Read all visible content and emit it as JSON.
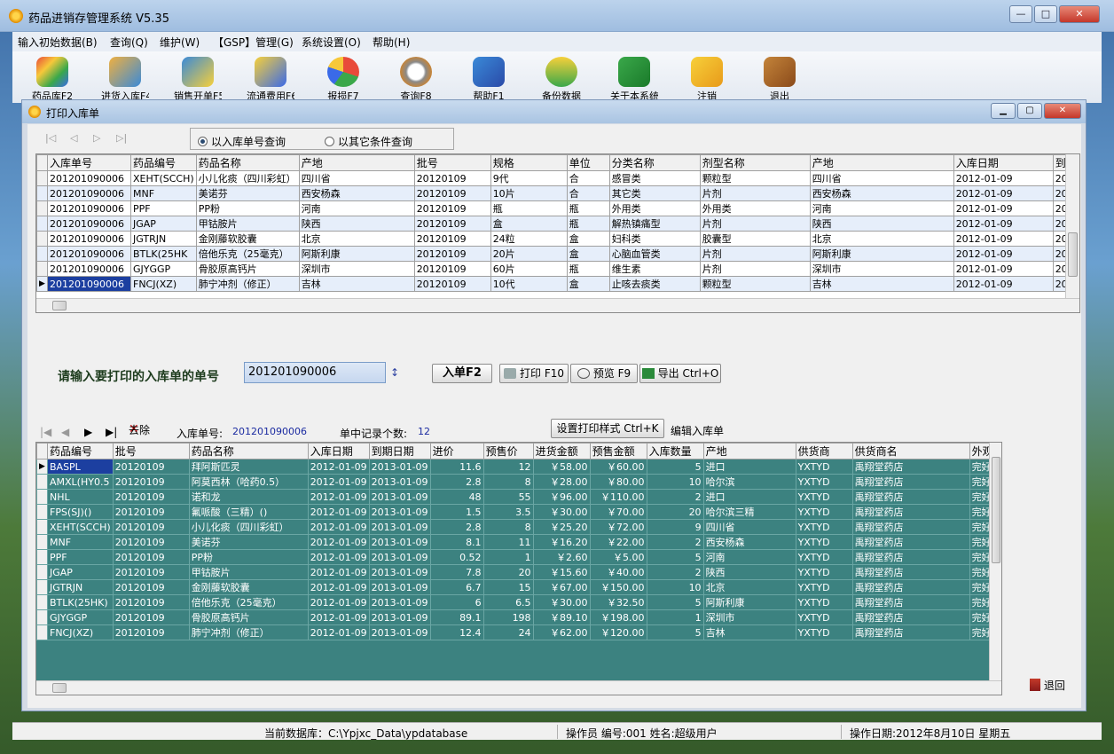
{
  "window": {
    "title": "药品进销存管理系统 V5.35",
    "min": "—",
    "max": "□",
    "close": "✕"
  },
  "menu": [
    "输入初始数据(B)",
    "查询(Q)",
    "维护(W)",
    "【GSP】管理(G)",
    "系统设置(O)",
    "帮助(H)"
  ],
  "toolbar": [
    "药品库F2",
    "进货入库F4",
    "销售开单F5",
    "流通费用F6",
    "报损F7",
    "查询F8",
    "帮助F1",
    "备份数据",
    "关于本系统",
    "注销",
    "退出"
  ],
  "child": {
    "title": "打印入库单",
    "min": "▁",
    "max": "▢",
    "close": "✕"
  },
  "radio": {
    "option1": "以入库单号查询",
    "option2": "以其它条件查询"
  },
  "upper_grid": {
    "columns": [
      "入库单号",
      "药品编号",
      "药品名称",
      "产地",
      "批号",
      "规格",
      "单位",
      "分类名称",
      "剂型名称",
      "产地",
      "入库日期",
      "到"
    ],
    "rows": [
      [
        "201201090006",
        "XEHT(SCCH)",
        "小儿化痰（四川彩虹）",
        "四川省",
        "20120109",
        "9代",
        "合",
        "感冒类",
        "颗粒型",
        "四川省",
        "2012-01-09",
        "20"
      ],
      [
        "201201090006",
        "MNF",
        "美诺芬",
        "西安杨森",
        "20120109",
        "10片",
        "合",
        "其它类",
        "片剂",
        "西安杨森",
        "2012-01-09",
        "20"
      ],
      [
        "201201090006",
        "PPF",
        "PP粉",
        "河南",
        "20120109",
        "瓶",
        "瓶",
        "外用类",
        "外用类",
        "河南",
        "2012-01-09",
        "20"
      ],
      [
        "201201090006",
        "JGAP",
        "甲钴胺片",
        "陕西",
        "20120109",
        "盒",
        "瓶",
        "解热镇痛型",
        "片剂",
        "陕西",
        "2012-01-09",
        "20"
      ],
      [
        "201201090006",
        "JGTRJN",
        "金刚藤软胶囊",
        "北京",
        "20120109",
        "24粒",
        "盒",
        "妇科类",
        "胶囊型",
        "北京",
        "2012-01-09",
        "20"
      ],
      [
        "201201090006",
        "BTLK(25HK",
        "倍他乐克（25毫克）",
        "阿斯利康",
        "20120109",
        "20片",
        "盒",
        "心脑血管类",
        "片剂",
        "阿斯利康",
        "2012-01-09",
        "20"
      ],
      [
        "201201090006",
        "GJYGGP",
        "骨胶原高钙片",
        "深圳市",
        "20120109",
        "60片",
        "瓶",
        "维生素",
        "片剂",
        "深圳市",
        "2012-01-09",
        "20"
      ],
      [
        "201201090006",
        "FNCJ(XZ)",
        "肺宁冲剂（修正）",
        "吉林",
        "20120109",
        "10代",
        "盒",
        "止咳去痰类",
        "颗粒型",
        "吉林",
        "2012-01-09",
        "20"
      ]
    ]
  },
  "prompt": "请输入要打印的入库单的单号",
  "input_value": "201201090006",
  "buttons": {
    "ruku": "入单F2",
    "print": "打印 F10",
    "preview": "预览 F9",
    "export": "导出 Ctrl+O",
    "set_style": "设置打印样式 Ctrl+K",
    "edit": "编辑入库单",
    "delete": "去除",
    "back": "退回"
  },
  "lower_info": {
    "label_no": "入库单号:",
    "no": "201201090006",
    "label_count": "单中记录个数:",
    "count": "12"
  },
  "lower_grid": {
    "columns": [
      "药品编号",
      "批号",
      "药品名称",
      "入库日期",
      "到期日期",
      "进价",
      "预售价",
      "进货金额",
      "预售金额",
      "入库数量",
      "产地",
      "供货商",
      "供货商名",
      "外观"
    ],
    "rows": [
      [
        "BASPL",
        "20120109",
        "拜阿斯匹灵",
        "2012-01-09",
        "2013-01-09",
        "11.6",
        "12",
        "￥58.00",
        "￥60.00",
        "5",
        "进口",
        "YXTYD",
        "禹翔堂药店",
        "完好"
      ],
      [
        "AMXL(HY0.5",
        "20120109",
        "阿莫西林（哈药0.5）",
        "2012-01-09",
        "2013-01-09",
        "2.8",
        "8",
        "￥28.00",
        "￥80.00",
        "10",
        "哈尔滨",
        "YXTYD",
        "禹翔堂药店",
        "完好"
      ],
      [
        "NHL",
        "20120109",
        "诺和龙",
        "2012-01-09",
        "2013-01-09",
        "48",
        "55",
        "￥96.00",
        "￥110.00",
        "2",
        "进口",
        "YXTYD",
        "禹翔堂药店",
        "完好"
      ],
      [
        "FPS(SJ)()",
        "20120109",
        "氟哌酸（三精）()",
        "2012-01-09",
        "2013-01-09",
        "1.5",
        "3.5",
        "￥30.00",
        "￥70.00",
        "20",
        "哈尔滨三精",
        "YXTYD",
        "禹翔堂药店",
        "完好"
      ],
      [
        "XEHT(SCCH)",
        "20120109",
        "小儿化痰（四川彩虹）",
        "2012-01-09",
        "2013-01-09",
        "2.8",
        "8",
        "￥25.20",
        "￥72.00",
        "9",
        "四川省",
        "YXTYD",
        "禹翔堂药店",
        "完好"
      ],
      [
        "MNF",
        "20120109",
        "美诺芬",
        "2012-01-09",
        "2013-01-09",
        "8.1",
        "11",
        "￥16.20",
        "￥22.00",
        "2",
        "西安杨森",
        "YXTYD",
        "禹翔堂药店",
        "完好"
      ],
      [
        "PPF",
        "20120109",
        "PP粉",
        "2012-01-09",
        "2013-01-09",
        "0.52",
        "1",
        "￥2.60",
        "￥5.00",
        "5",
        "河南",
        "YXTYD",
        "禹翔堂药店",
        "完好"
      ],
      [
        "JGAP",
        "20120109",
        "甲钴胺片",
        "2012-01-09",
        "2013-01-09",
        "7.8",
        "20",
        "￥15.60",
        "￥40.00",
        "2",
        "陕西",
        "YXTYD",
        "禹翔堂药店",
        "完好"
      ],
      [
        "JGTRJN",
        "20120109",
        "金刚藤软胶囊",
        "2012-01-09",
        "2013-01-09",
        "6.7",
        "15",
        "￥67.00",
        "￥150.00",
        "10",
        "北京",
        "YXTYD",
        "禹翔堂药店",
        "完好"
      ],
      [
        "BTLK(25HK)",
        "20120109",
        "倍他乐克（25毫克）",
        "2012-01-09",
        "2013-01-09",
        "6",
        "6.5",
        "￥30.00",
        "￥32.50",
        "5",
        "阿斯利康",
        "YXTYD",
        "禹翔堂药店",
        "完好"
      ],
      [
        "GJYGGP",
        "20120109",
        "骨胶原高钙片",
        "2012-01-09",
        "2013-01-09",
        "89.1",
        "198",
        "￥89.10",
        "￥198.00",
        "1",
        "深圳市",
        "YXTYD",
        "禹翔堂药店",
        "完好"
      ],
      [
        "FNCJ(XZ)",
        "20120109",
        "肺宁冲剂（修正）",
        "2012-01-09",
        "2013-01-09",
        "12.4",
        "24",
        "￥62.00",
        "￥120.00",
        "5",
        "吉林",
        "YXTYD",
        "禹翔堂药店",
        "完好"
      ]
    ]
  },
  "status": {
    "db": "当前数据库：C:\\Ypjxc_Data\\ypdatabase",
    "operator": "操作员 编号:001  姓名:超级用户",
    "date": "操作日期:2012年8月10日 星期五"
  },
  "colors": {
    "teal": "#3c8280",
    "select": "#1c3fa0"
  }
}
